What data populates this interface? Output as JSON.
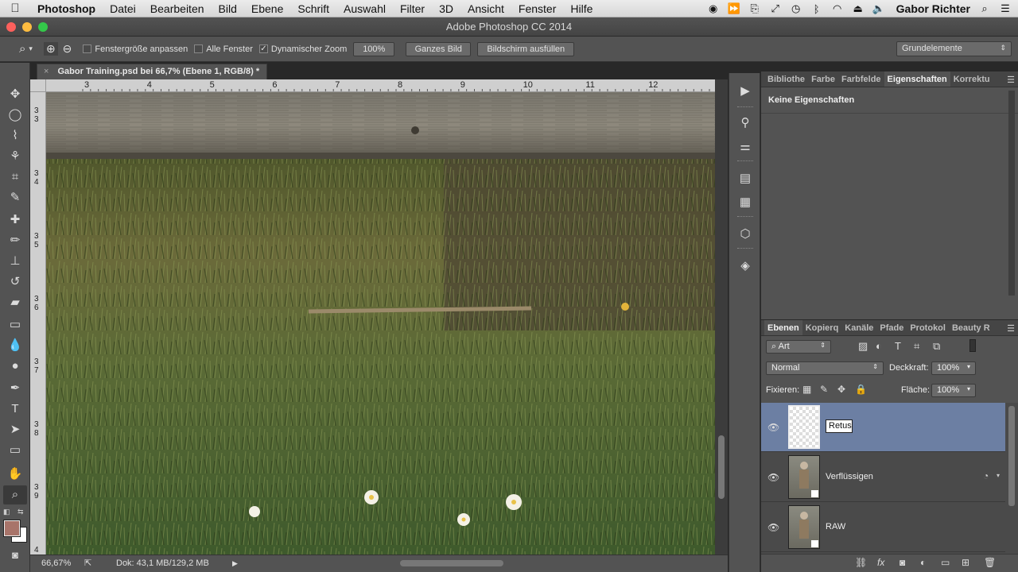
{
  "menubar": {
    "app": "Photoshop",
    "items": [
      "Datei",
      "Bearbeiten",
      "Bild",
      "Ebene",
      "Schrift",
      "Auswahl",
      "Filter",
      "3D",
      "Ansicht",
      "Fenster",
      "Hilfe"
    ],
    "user": "Gabor Richter"
  },
  "window": {
    "title": "Adobe Photoshop CC 2014"
  },
  "options": {
    "fit_window_label": "Fenstergröße anpassen",
    "all_windows_label": "Alle Fenster",
    "dynamic_zoom_label": "Dynamischer Zoom",
    "zoom_value": "100%",
    "whole_image_button": "Ganzes Bild",
    "fill_screen_button": "Bildschirm ausfüllen",
    "workspace": "Grundelemente"
  },
  "document": {
    "tab_title": "Gabor Training.psd bei 66,7% (Ebene 1, RGB/8) *",
    "ruler_h": [
      "3",
      "4",
      "5",
      "6",
      "7",
      "8",
      "9",
      "10",
      "11",
      "12"
    ],
    "ruler_v": [
      "33",
      "34",
      "35",
      "36",
      "37",
      "38",
      "39",
      "4"
    ]
  },
  "status": {
    "zoom": "66,67%",
    "doc_info": "Dok: 43,1 MB/129,2 MB"
  },
  "properties_panel": {
    "tabs": [
      "Bibliothe",
      "Farbe",
      "Farbfelde",
      "Eigenschaften",
      "Korrektu"
    ],
    "active_tab": "Eigenschaften",
    "content": "Keine Eigenschaften"
  },
  "layers_panel": {
    "tabs": [
      "Ebenen",
      "Kopierq",
      "Kanäle",
      "Pfade",
      "Protokol",
      "Beauty R"
    ],
    "filter_label": "Art",
    "blend_mode": "Normal",
    "opacity_label": "Deckkraft:",
    "opacity_value": "100%",
    "lock_label": "Fixieren:",
    "fill_label": "Fläche:",
    "fill_value": "100%",
    "layers": [
      {
        "name": "Retus",
        "editing": true
      },
      {
        "name": "Verflüssigen"
      },
      {
        "name": "RAW"
      }
    ]
  },
  "colors": {
    "foreground": "#a8746a",
    "background": "#ffffff",
    "selected_layer": "#6c7fa3"
  }
}
